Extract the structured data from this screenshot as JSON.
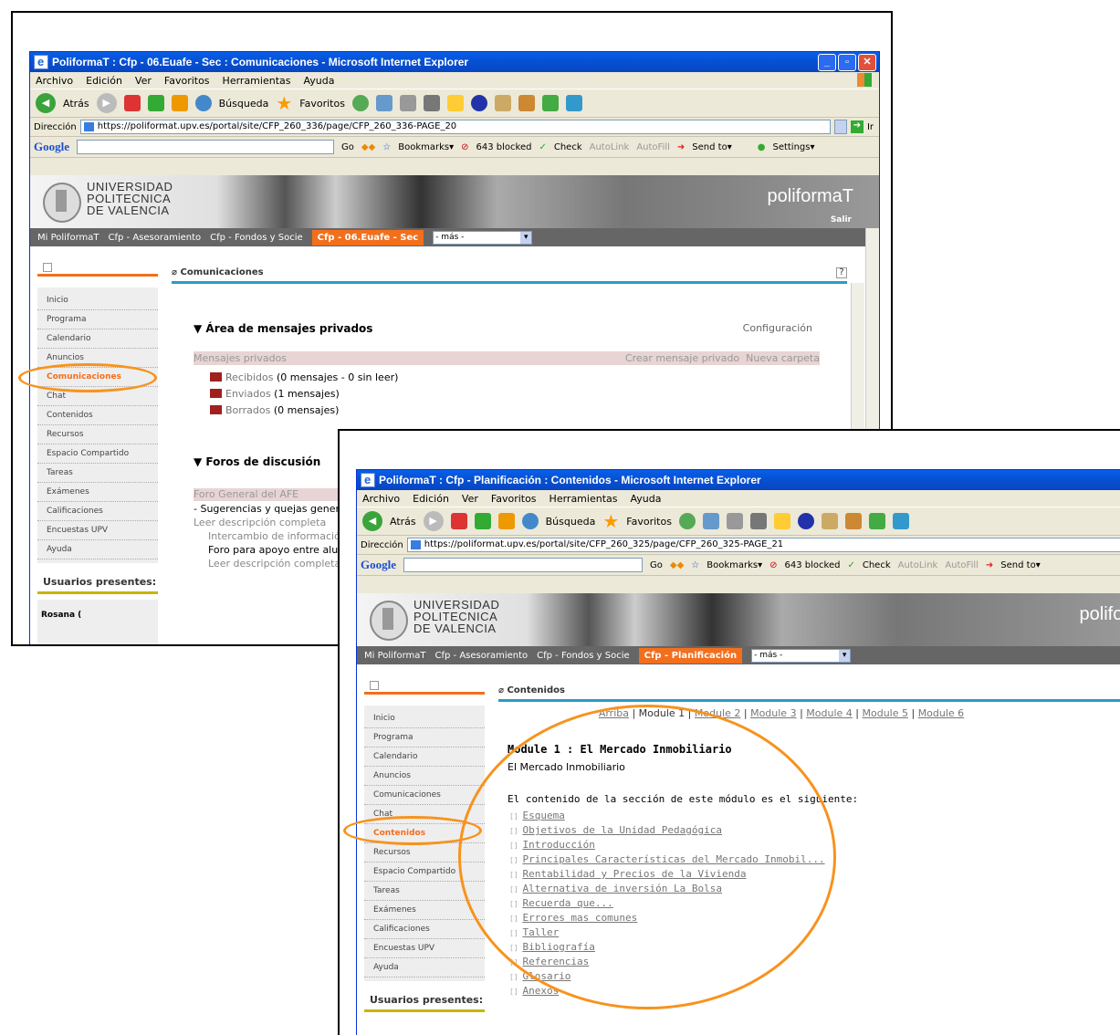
{
  "w1": {
    "title": "PoliformaT : Cfp - 06.Euafe - Sec : Comunicaciones - Microsoft Internet Explorer",
    "menu": [
      "Archivo",
      "Edición",
      "Ver",
      "Favoritos",
      "Herramientas",
      "Ayuda"
    ],
    "toolbar": {
      "back": "Atrás",
      "search": "Búsqueda",
      "favorites": "Favoritos"
    },
    "address_label": "Dirección",
    "url": "https://poliformat.upv.es/portal/site/CFP_260_336/page/CFP_260_336-PAGE_20",
    "go": "Ir",
    "gbar": {
      "go": "Go",
      "bookmarks": "Bookmarks▾",
      "blocked": "643 blocked",
      "check": "Check",
      "autolink": "AutoLink",
      "autofill": "AutoFill",
      "sendto": "Send to▾",
      "settings": "Settings▾"
    },
    "uni": [
      "UNIVERSIDAD",
      "POLITECNICA",
      "DE VALENCIA"
    ],
    "brand": "poliformaT",
    "salir": "Salir",
    "nav": [
      "Mi PoliformaT",
      "Cfp - Asesoramiento",
      "Cfp - Fondos y Socie"
    ],
    "nav_active": "Cfp - 06.Euafe - Sec",
    "nav_more": "- más -",
    "tools": [
      "Inicio",
      "Programa",
      "Calendario",
      "Anuncios",
      "Comunicaciones",
      "Chat",
      "Contenidos",
      "Recursos",
      "Espacio Compartido",
      "Tareas",
      "Exámenes",
      "Calificaciones",
      "Encuestas UPV",
      "Ayuda"
    ],
    "presence": "Usuarios presentes:",
    "user": "Rosana (",
    "panel_title": "Comunicaciones",
    "help": "?",
    "priv_title": "Área de mensajes privados",
    "config": "Configuración",
    "priv_label": "Mensajes privados",
    "create": "Crear mensaje privado",
    "new_folder": "Nueva carpeta",
    "folders": [
      {
        "name": "Recibidos",
        "info": "(0 mensajes - 0 sin leer)"
      },
      {
        "name": "Enviados",
        "info": "(1 mensajes)"
      },
      {
        "name": "Borrados",
        "info": "(0 mensajes)"
      }
    ],
    "forums_title": "Foros de discusión",
    "forum_general": "Foro General del AFE",
    "forum_sug": "- Sugerencias y quejas genera",
    "read_desc": "Leer descripción completa",
    "sub1": "Intercambio de información",
    "sub2": "Foro para apoyo entre alum",
    "read_desc2": "Leer descripción completa"
  },
  "w2": {
    "title": "PoliformaT : Cfp - Planificación : Contenidos - Microsoft Internet Explorer",
    "menu": [
      "Archivo",
      "Edición",
      "Ver",
      "Favoritos",
      "Herramientas",
      "Ayuda"
    ],
    "toolbar": {
      "back": "Atrás",
      "search": "Búsqueda",
      "favorites": "Favoritos"
    },
    "address_label": "Dirección",
    "url": "https://poliformat.upv.es/portal/site/CFP_260_325/page/CFP_260_325-PAGE_21",
    "gbar": {
      "go": "Go",
      "bookmarks": "Bookmarks▾",
      "blocked": "643 blocked",
      "check": "Check",
      "autolink": "AutoLink",
      "autofill": "AutoFill",
      "sendto": "Send to▾"
    },
    "uni": [
      "UNIVERSIDAD",
      "POLITECNICA",
      "DE VALENCIA"
    ],
    "brand": "polifor",
    "nav": [
      "Mi PoliformaT",
      "Cfp - Asesoramiento",
      "Cfp - Fondos y Socie"
    ],
    "nav_active": "Cfp - Planificación",
    "nav_more": "- más -",
    "tools": [
      "Inicio",
      "Programa",
      "Calendario",
      "Anuncios",
      "Comunicaciones",
      "Chat",
      "Contenidos",
      "Recursos",
      "Espacio Compartido",
      "Tareas",
      "Exámenes",
      "Calificaciones",
      "Encuestas UPV",
      "Ayuda"
    ],
    "presence": "Usuarios presentes:",
    "panel_title": "Contenidos",
    "modnav": {
      "up": "Arriba",
      "current": "Module 1",
      "others": [
        "Module 2",
        "Module 3",
        "Module 4",
        "Module 5",
        "Module 6"
      ]
    },
    "module_title": "Module 1 : El Mercado Inmobiliario",
    "module_sub": "El Mercado Inmobiliario",
    "intro": "El contenido de la sección de este módulo es el siguiente:",
    "items": [
      "Esquema",
      "Objetivos de la Unidad Pedagógica",
      "Introducción",
      "Principales Características del Mercado Inmobil...",
      "Rentabilidad y Precios de la Vivienda",
      "Alternativa de inversión La Bolsa",
      "Recuerda que...",
      "Errores mas comunes",
      "Taller",
      "Bibliografía",
      "Referencias",
      "Glosario",
      "Anexos"
    ]
  }
}
